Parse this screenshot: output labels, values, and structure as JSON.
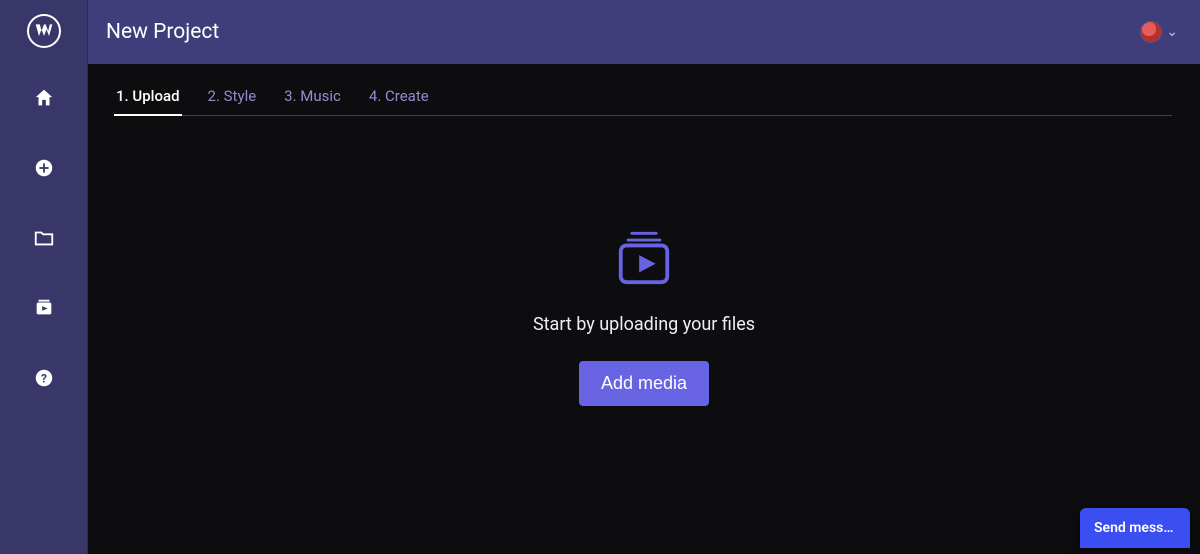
{
  "header": {
    "title": "New Project"
  },
  "sidebar": {
    "logo_name": "app-logo",
    "items": [
      {
        "name": "home-icon"
      },
      {
        "name": "add-icon"
      },
      {
        "name": "folder-icon"
      },
      {
        "name": "library-icon"
      },
      {
        "name": "help-icon"
      }
    ]
  },
  "tabs": [
    {
      "label": "1. Upload",
      "active": true
    },
    {
      "label": "2. Style",
      "active": false
    },
    {
      "label": "3. Music",
      "active": false
    },
    {
      "label": "4. Create",
      "active": false
    }
  ],
  "hero": {
    "icon_name": "media-box-play-icon",
    "text": "Start by uploading your files",
    "button_label": "Add media"
  },
  "chat": {
    "label": "Send messa…"
  },
  "colors": {
    "sidebar_bg": "#393769",
    "header_bg": "#403e7a",
    "accent": "#6763e3",
    "tab_inactive": "#8f8ed1",
    "chat_bg": "#3a4ef2"
  }
}
